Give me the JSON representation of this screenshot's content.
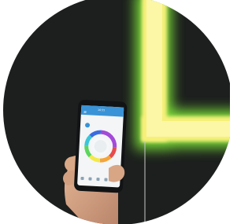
{
  "scene": {
    "background_color": "#ffffff",
    "circle_color": "#1c1f1e",
    "glow_color": "#9cf23a",
    "strip_color": "#f6f079",
    "phone_header_color": "#3a93d6",
    "hand_color": "#d7a584"
  },
  "phone": {
    "status_time": "16:55",
    "app_header_glyph": "≡",
    "wheel_icon": "color-wheel-icon",
    "bottom_nav": [
      "home-icon",
      "scene-icon",
      "music-icon",
      "timer-icon",
      "settings-icon"
    ]
  }
}
